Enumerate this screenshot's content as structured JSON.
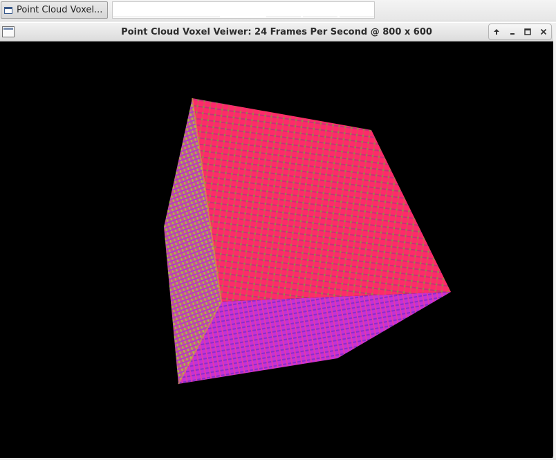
{
  "taskbar": {
    "task_label": "Point Cloud Voxel...",
    "task_icon": "window-icon"
  },
  "window": {
    "title": "Point Cloud Voxel Veiwer: 24 Frames Per Second @ 800 x 600",
    "controls": [
      "shade-icon",
      "minimize-icon",
      "maximize-icon",
      "close-icon"
    ]
  },
  "scene": {
    "object": "voxel-cube",
    "background": "#000000",
    "colors": {
      "front_face": "#ff2a6a",
      "bottom_face": "#cc33dd",
      "left_face": "#b0d040",
      "edge_accent": "#ffd54a"
    }
  }
}
